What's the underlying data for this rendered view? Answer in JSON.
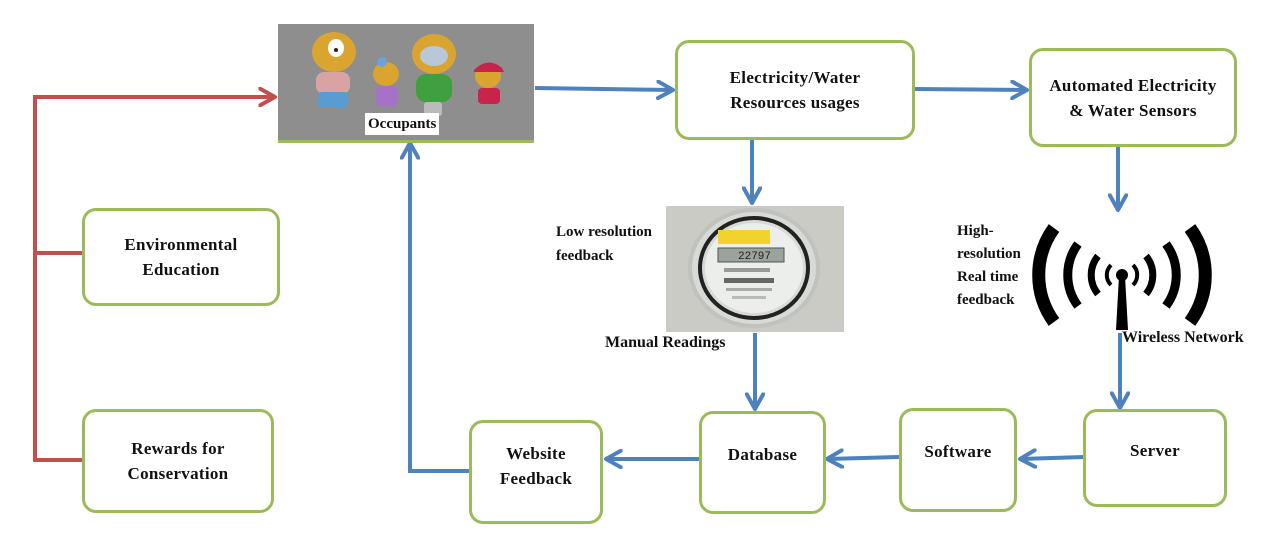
{
  "diagram": {
    "nodes": {
      "occupants": "Occupants",
      "usage": [
        "Electricity/Water",
        "Resources usages"
      ],
      "sensors": [
        "Automated Electricity",
        "& Water Sensors"
      ],
      "env_education": [
        "Environmental",
        "Education"
      ],
      "rewards": [
        "Rewards for",
        "Conservation"
      ],
      "website": [
        "Website",
        "Feedback"
      ],
      "database": "Database",
      "software": "Software",
      "server": "Server"
    },
    "labels": {
      "low_res": [
        "Low resolution",
        "feedback"
      ],
      "manual": "Manual Readings",
      "high_res": [
        "High-",
        "resolution",
        "Real time",
        "feedback"
      ],
      "wireless": "Wireless Network"
    },
    "meter_display": "22797",
    "colors": {
      "node_border": "#9bbb59",
      "flow_arrow": "#4f81bd",
      "feedback_arrow": "#c0504d"
    },
    "edges": [
      {
        "from": "Occupants",
        "to": "Electricity/Water Resources usages"
      },
      {
        "from": "Electricity/Water Resources usages",
        "to": "Automated Electricity & Water Sensors"
      },
      {
        "from": "Electricity/Water Resources usages",
        "to": "Manual Readings"
      },
      {
        "from": "Manual Readings",
        "to": "Database"
      },
      {
        "from": "Automated Electricity & Water Sensors",
        "to": "Wireless Network"
      },
      {
        "from": "Wireless Network",
        "to": "Server"
      },
      {
        "from": "Server",
        "to": "Software"
      },
      {
        "from": "Software",
        "to": "Database"
      },
      {
        "from": "Database",
        "to": "Website Feedback"
      },
      {
        "from": "Website Feedback",
        "to": "Occupants"
      },
      {
        "from": "Environmental Education",
        "to": "Occupants"
      },
      {
        "from": "Rewards for Conservation",
        "to": "Occupants"
      }
    ]
  }
}
